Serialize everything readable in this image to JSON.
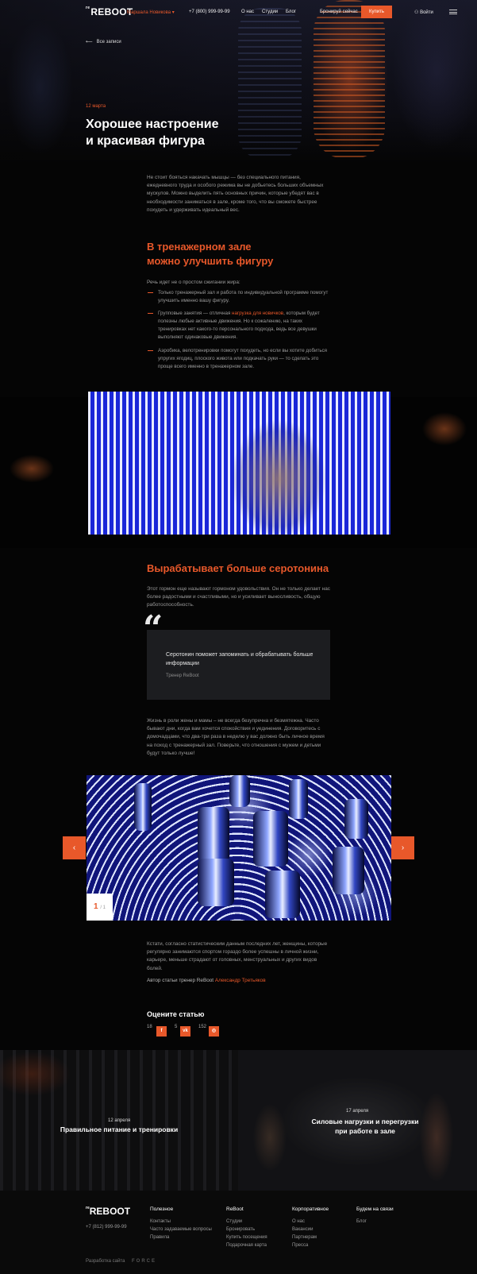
{
  "header": {
    "logo": "REBOOT",
    "logo_prefix": "re",
    "city": "Маршала Новикова",
    "phone": "+7 (800) 999-99-99",
    "nav": [
      "О нас",
      "Студии",
      "Блог"
    ],
    "book": "Бронируй сейчас",
    "buy": "Купить",
    "login": "Войти"
  },
  "article": {
    "back": "Все записи",
    "date": "12 марта",
    "title_line1": "Хорошее настроение",
    "title_line2": "и красивая фигура",
    "intro": "Не стоит бояться накачать мышцы — без специального питания, ежедневного труда и особого режима вы не добьетесь больших объемных мускулов. Можно выделить пять основных причин, которые убедят вас в необходимости заниматься в зале, кроме того, что вы сможете быстрее похудеть и удерживать идеальный вес.",
    "h2_line1": "В тренажерном зале",
    "h2_line2": "можно улучшить фигуру",
    "lead": "Речь идет не о простом сжигании жира:",
    "list": [
      {
        "text": "Только тренажерный зал и работа по индивидуальной программе помогут улучшить именно вашу фигуру."
      },
      {
        "before": "Групповые занятия — отличная ",
        "link": "нагрузка для новичков",
        "after": ", которым будет полезны любые активные движения. Но к сожалению, на таких тренировках нет какого-то персонального подхода, ведь все девушки выполняют одинаковые движения."
      },
      {
        "text": "Аэробика, велотренировки помогут похудеть, но если вы хотите добиться упругих ягодиц, плоского живота или подкачать руки — то сделать это проще всего именно в тренажерном зале."
      }
    ],
    "h2b": "Вырабатывает больше серотонина",
    "para2": "Этот гормон еще называют гормоном удовольствия. Он не только делает нас более радостными и счастливыми, но и усиливает выносливость, общую работоспособность.",
    "quote": "Серотонин поможет запоминать и обрабатывать больше информации",
    "quote_author": "Тренер ReBoot",
    "para3": "Жизнь в роли жены и мамы – не всегда безупречна и безмятежна. Часто бывают дни, когда вам хочется спокойствия и уединения. Договоритесь с домочадцами, что два-три раза в неделю у вас должно быть личное время на поход с тренажерный зал. Поверьте, что отношения с мужем и детьми будут только лучше!",
    "slider": {
      "current": "1",
      "total": "1",
      "prev": "‹",
      "next": "›"
    },
    "para4": "Кстати, согласно статистическим данным последних лет, женщины, которые регулярно занимаются спортом гораздо более успешны в личной жизни, карьере, меньше страдают от головных, менструальных и других видов болей.",
    "author_label": "Автор статьи тренер ReBoot",
    "author_name": "Александр Третьяков"
  },
  "rating": {
    "title": "Оцените статью",
    "fb_count": "18",
    "fb_icon": "f",
    "vk_count": "5",
    "vk_icon": "vk",
    "ig_count": "152",
    "ig_icon": "◎"
  },
  "related": [
    {
      "date": "12 апреля",
      "title": "Правильное питание и тренировки"
    },
    {
      "date": "17 апреля",
      "title_line1": "Силовые нагрузки и перегрузки",
      "title_line2": "при работе в зале"
    }
  ],
  "footer": {
    "logo": "REBOOT",
    "logo_prefix": "re",
    "phone": "+7 (812) 999-99-99",
    "cols": [
      {
        "title": "Полезное",
        "links": [
          "Контакты",
          "Часто задаваемые вопросы",
          "Правила"
        ]
      },
      {
        "title": "ReBoot",
        "links": [
          "Студии",
          "Бронировать",
          "Купить посещения",
          "Подарочная карта"
        ]
      },
      {
        "title": "Корпоративное",
        "links": [
          "О нас",
          "Вакансии",
          "Партнерам",
          "Пресса"
        ]
      },
      {
        "title": "Будем на связи",
        "links": [
          "Блог"
        ]
      }
    ],
    "dev_label": "Разработка сайта",
    "dev_name": "FORCE"
  },
  "colors": {
    "accent": "#e8582a",
    "background": "#050505"
  }
}
